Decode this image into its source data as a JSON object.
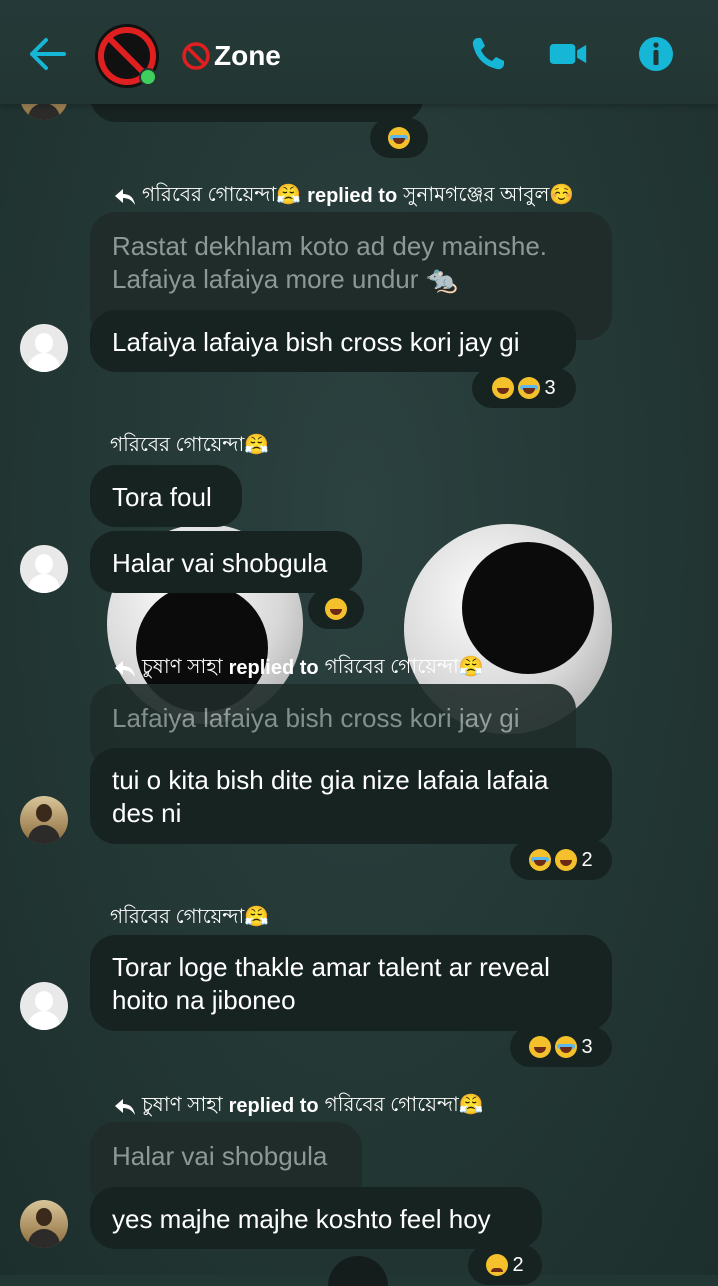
{
  "header": {
    "title": "Zone",
    "icons": [
      "back-arrow-icon",
      "prohibited-icon",
      "phone-icon",
      "video-camera-icon",
      "info-icon"
    ],
    "accent": "#16b6d6"
  },
  "messages": [
    {
      "reactions": "",
      "count": ""
    },
    {
      "reply_sender": "গরিবের গোয়েন্দা😤",
      "reply_word": "replied to",
      "reply_target": "সুনামগঞ্জের আবুল☺️",
      "quote": "Rastat dekhlam koto ad dey mainshe. Lafaiya lafaiya more undur 🐀",
      "text": "Lafaiya lafaiya bish cross kori jay gi",
      "count": "3"
    },
    {
      "sender": "গরিবের গোয়েন্দা😤",
      "text1": "Tora foul",
      "text2": "Halar vai shobgula"
    },
    {
      "reply_sender": "চুষাণ সাহা",
      "reply_word": "replied to",
      "reply_target": "গরিবের গোয়েন্দা😤",
      "quote": "Lafaiya lafaiya bish cross kori jay gi",
      "text": "tui o kita bish dite gia nize lafaia lafaia des ni",
      "count": "2"
    },
    {
      "sender": "গরিবের গোয়েন্দা😤",
      "text": "Torar loge thakle amar talent ar reveal hoito na jiboneo",
      "count": "3"
    },
    {
      "reply_sender": "চুষাণ সাহা",
      "reply_word": "replied to",
      "reply_target": "গরিবের গোয়েন্দা😤",
      "quote": "Halar vai shobgula",
      "text": "yes majhe majhe koshto feel hoy",
      "count": "2"
    }
  ]
}
